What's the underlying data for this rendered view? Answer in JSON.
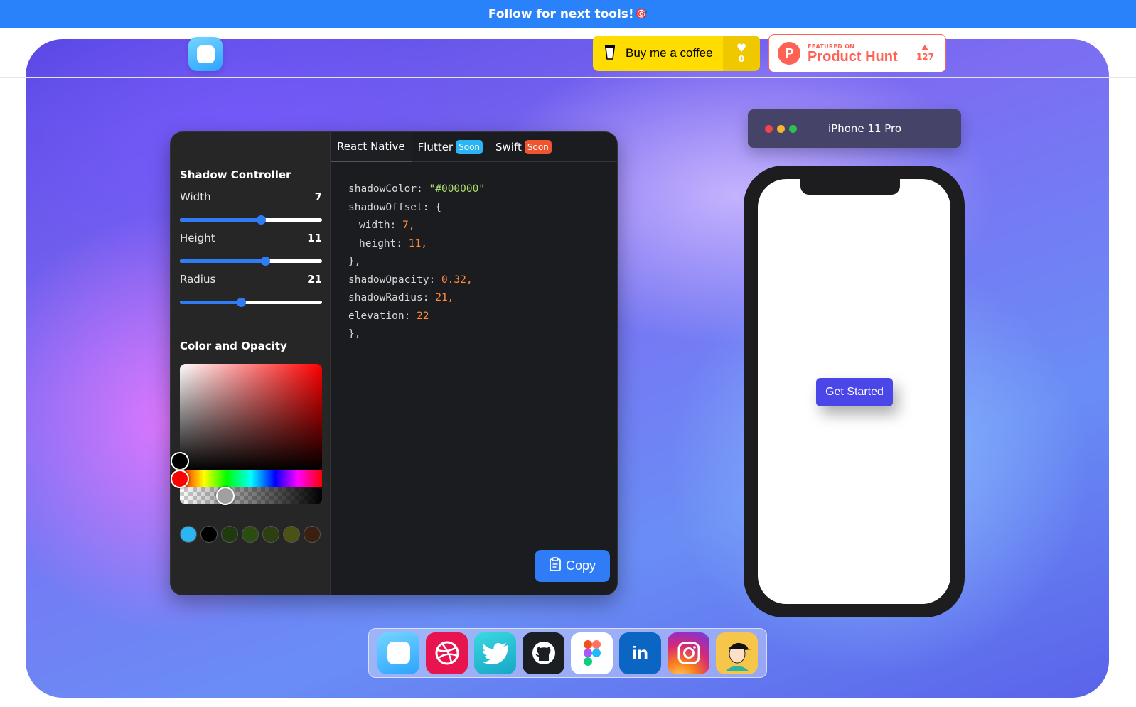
{
  "banner": {
    "text": "Follow for next tools!",
    "icon": "target-icon",
    "color": "#2a82fb"
  },
  "header": {
    "logo": "app-logo-icon",
    "coffee": {
      "label": "Buy me a coffee",
      "count": "0",
      "color": "#ffdd00"
    },
    "product_hunt": {
      "featured": "FEATURED ON",
      "name": "Product Hunt",
      "votes": "127",
      "color": "#ff6154"
    }
  },
  "editor": {
    "controller_title": "Shadow Controller",
    "controls": [
      {
        "label": "Width",
        "value": "7",
        "level": 0.57
      },
      {
        "label": "Height",
        "value": "11",
        "level": 0.6
      },
      {
        "label": "Radius",
        "value": "21",
        "level": 0.43
      }
    ],
    "color_title": "Color and Opacity",
    "swatches": [
      "#2bb5f5",
      "#000000",
      "#1f3a0f",
      "#2a4d10",
      "#2b3f10",
      "#4a5216",
      "#3a2010"
    ],
    "tabs": [
      {
        "label": "React Native",
        "badge": ""
      },
      {
        "label": "Flutter",
        "badge": "Soon",
        "badge_color": "#2bb5f5"
      },
      {
        "label": "Swift",
        "badge": "Soon",
        "badge_color": "#f0552f"
      }
    ],
    "code": {
      "l1_key": "shadowColor: ",
      "l1_val": "\"#000000\"",
      "l2": "shadowOffset: {",
      "l3_key": "width: ",
      "l3_val": "7,",
      "l4_key": "height: ",
      "l4_val": "11,",
      "l5": "},",
      "l6_key": "shadowOpacity: ",
      "l6_val": "0.32,",
      "l7_key": "shadowRadius: ",
      "l7_val": "21,",
      "l8_key": "elevation: ",
      "l8_val": "22",
      "l9": "},"
    },
    "copy_label": "Copy",
    "accent": "#2f7cf6"
  },
  "device": {
    "name": "iPhone 11 Pro",
    "button_label": "Get Started",
    "button_color": "#4a46e8"
  },
  "dock": [
    "app-logo-icon",
    "dribbble-icon",
    "twitter-icon",
    "github-icon",
    "figma-icon",
    "linkedin-icon",
    "instagram-icon",
    "avatar-icon"
  ]
}
